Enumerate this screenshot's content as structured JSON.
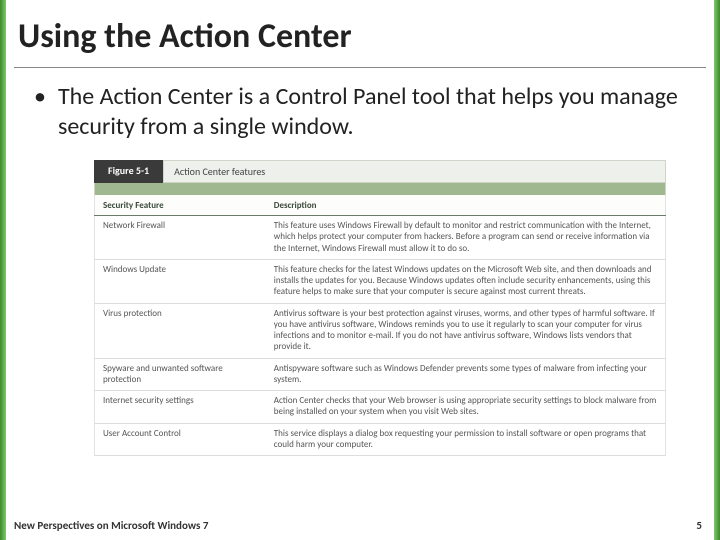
{
  "title": "Using the Action Center",
  "bullet_text": "The Action Center is a Control Panel tool that helps you manage security from a single window.",
  "figure": {
    "label": "Figure 5-1",
    "caption": "Action Center features",
    "columns": {
      "feature": "Security Feature",
      "description": "Description"
    },
    "rows": [
      {
        "feature": "Network Firewall",
        "description": "This feature uses Windows Firewall by default to monitor and restrict communication with the Internet, which helps protect your computer from hackers. Before a program can send or receive information via the Internet, Windows Firewall must allow it to do so."
      },
      {
        "feature": "Windows Update",
        "description": "This feature checks for the latest Windows updates on the Microsoft Web site, and then downloads and installs the updates for you. Because Windows updates often include security enhancements, using this feature helps to make sure that your computer is secure against most current threats."
      },
      {
        "feature": "Virus protection",
        "description": "Antivirus software is your best protection against viruses, worms, and other types of harmful software. If you have antivirus software, Windows reminds you to use it regularly to scan your computer for virus infections and to monitor e-mail. If you do not have antivirus software, Windows lists vendors that provide it."
      },
      {
        "feature": "Spyware and unwanted software protection",
        "description": "Antispyware software such as Windows Defender prevents some types of malware from infecting your system."
      },
      {
        "feature": "Internet security settings",
        "description": "Action Center checks that your Web browser is using appropriate security settings to block malware from being installed on your system when you visit Web sites."
      },
      {
        "feature": "User Account Control",
        "description": "This service displays a dialog box requesting your permission to install software or open programs that could harm your computer."
      }
    ]
  },
  "footer_left": "New Perspectives on Microsoft Windows 7",
  "footer_right": "5"
}
